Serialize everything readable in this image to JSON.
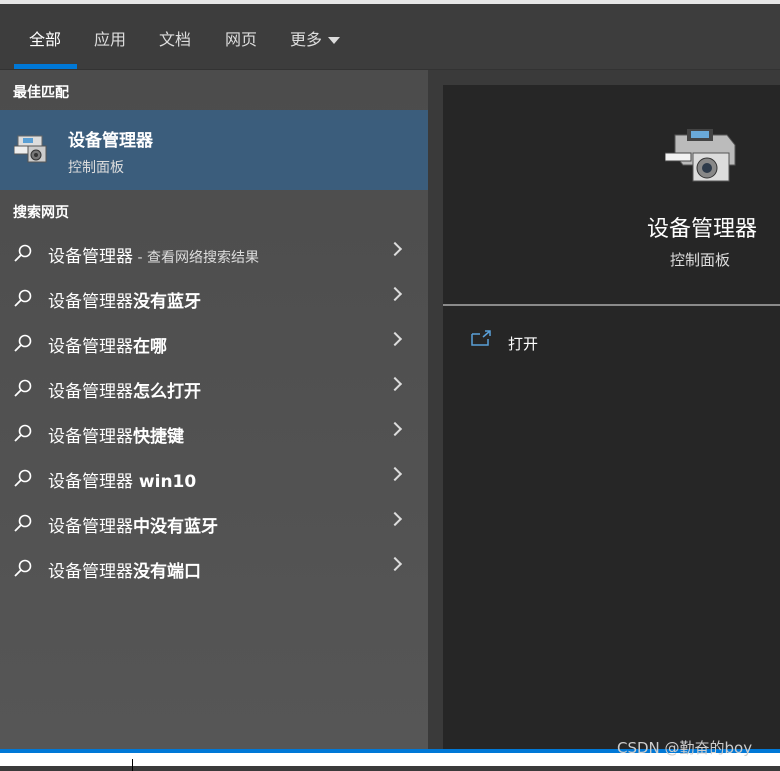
{
  "tabs": [
    {
      "label": "全部"
    },
    {
      "label": "应用"
    },
    {
      "label": "文档"
    },
    {
      "label": "网页"
    },
    {
      "label": "更多"
    }
  ],
  "best_match": {
    "heading": "最佳匹配",
    "title": "设备管理器",
    "subtitle": "控制面板"
  },
  "web": {
    "heading": "搜索网页",
    "items": [
      {
        "base": "设备管理器",
        "suffix": "",
        "hint": " - 查看网络搜索结果"
      },
      {
        "base": "设备管理器",
        "suffix": "没有蓝牙",
        "hint": ""
      },
      {
        "base": "设备管理器",
        "suffix": "在哪",
        "hint": ""
      },
      {
        "base": "设备管理器",
        "suffix": "怎么打开",
        "hint": ""
      },
      {
        "base": "设备管理器",
        "suffix": "快捷键",
        "hint": ""
      },
      {
        "base": "设备管理器",
        "suffix": " win10",
        "hint": ""
      },
      {
        "base": "设备管理器",
        "suffix": "中没有蓝牙",
        "hint": ""
      },
      {
        "base": "设备管理器",
        "suffix": "没有端口",
        "hint": ""
      }
    ]
  },
  "detail": {
    "title": "设备管理器",
    "subtitle": "控制面板",
    "open_label": "打开"
  },
  "watermark": "CSDN @勤奋的boy",
  "colors": {
    "accent": "#0078d7",
    "selected": "#3b5d7c"
  }
}
